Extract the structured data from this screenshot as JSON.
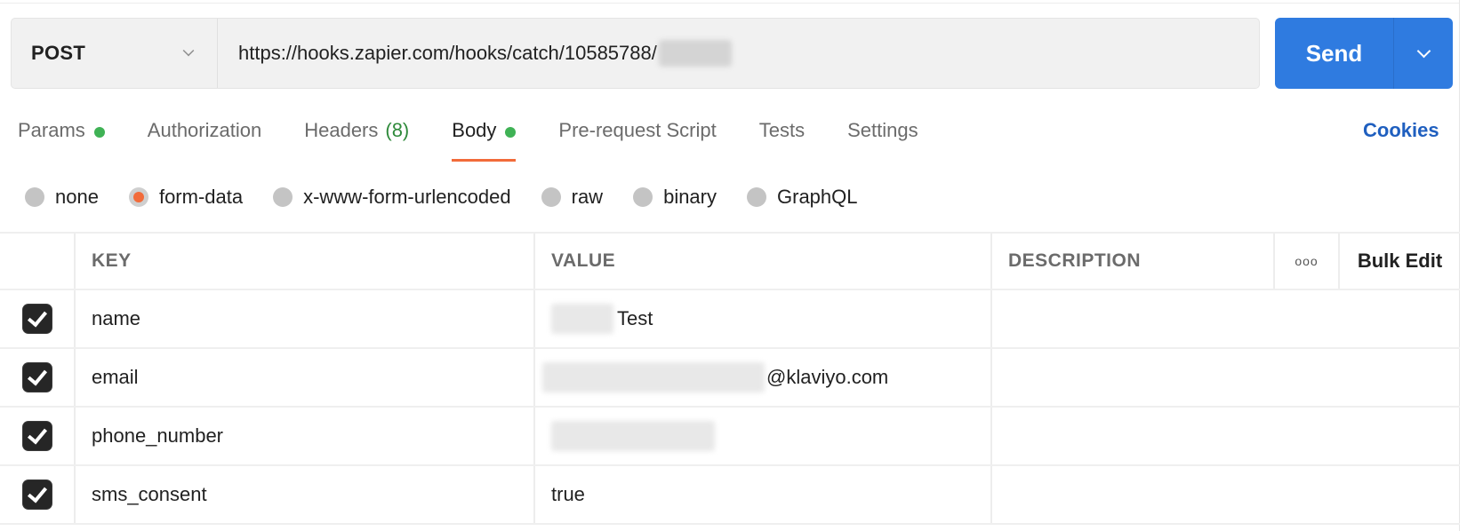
{
  "request": {
    "method": "POST",
    "url": "https://hooks.zapier.com/hooks/catch/10585788/",
    "url_redacted": true,
    "send_label": "Send"
  },
  "tabs": [
    {
      "label": "Params",
      "dot": true,
      "active": false
    },
    {
      "label": "Authorization",
      "active": false
    },
    {
      "label": "Headers",
      "count": "(8)",
      "active": false
    },
    {
      "label": "Body",
      "dot": true,
      "active": true
    },
    {
      "label": "Pre-request Script",
      "active": false
    },
    {
      "label": "Tests",
      "active": false
    },
    {
      "label": "Settings",
      "active": false
    }
  ],
  "cookies_label": "Cookies",
  "body_types": [
    {
      "label": "none",
      "checked": false
    },
    {
      "label": "form-data",
      "checked": true
    },
    {
      "label": "x-www-form-urlencoded",
      "checked": false
    },
    {
      "label": "raw",
      "checked": false
    },
    {
      "label": "binary",
      "checked": false
    },
    {
      "label": "GraphQL",
      "checked": false
    }
  ],
  "table": {
    "headers": {
      "key": "KEY",
      "value": "VALUE",
      "description": "DESCRIPTION",
      "more": "ooo",
      "bulk_edit": "Bulk Edit"
    },
    "rows": [
      {
        "checked": true,
        "key": "name",
        "value": "Test",
        "value_redacted_prefix": true,
        "description": ""
      },
      {
        "checked": true,
        "key": "email",
        "value": "@klaviyo.com",
        "value_redacted_prefix": true,
        "description": ""
      },
      {
        "checked": true,
        "key": "phone_number",
        "value": "",
        "value_redacted_prefix": true,
        "description": ""
      },
      {
        "checked": true,
        "key": "sms_consent",
        "value": "true",
        "value_redacted_prefix": false,
        "description": ""
      }
    ]
  },
  "colors": {
    "send_button": "#2f7be0",
    "active_tab_underline": "#f26b3a",
    "status_dot": "#3fb255",
    "cookies_link": "#1f5fbf"
  }
}
